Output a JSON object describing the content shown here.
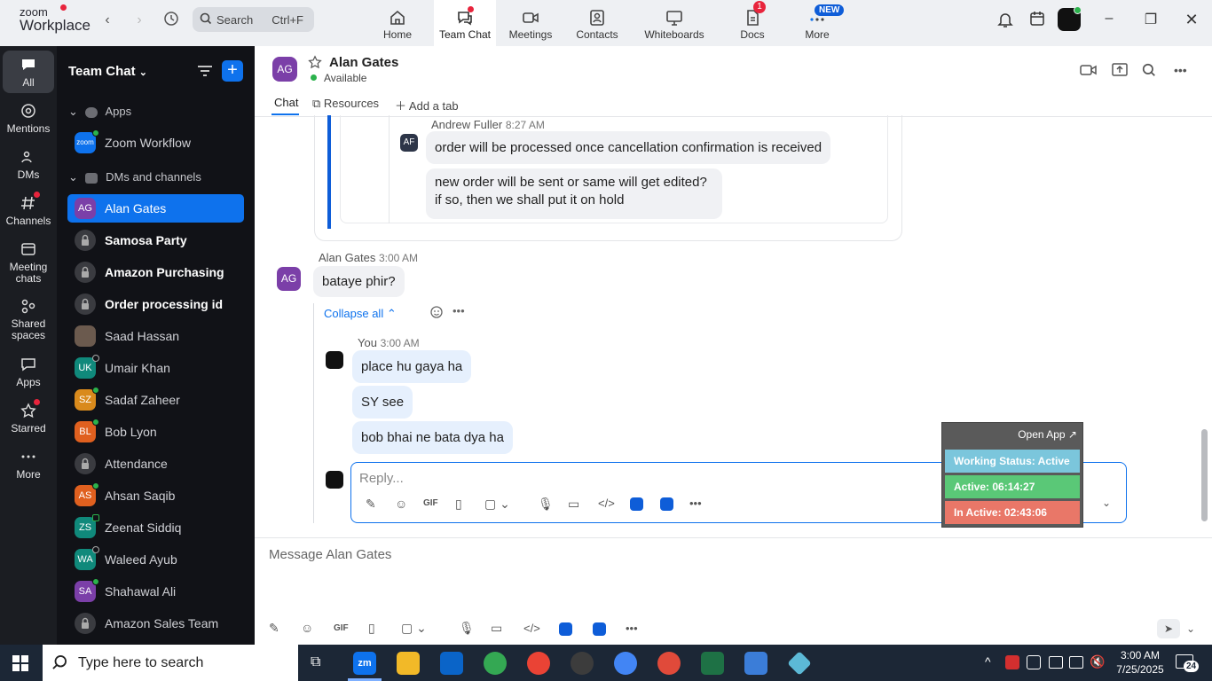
{
  "topbar": {
    "logo_line1": "zoom",
    "logo_line2": "Workplace",
    "search_placeholder": "Search",
    "search_shortcut": "Ctrl+F",
    "tabs": [
      {
        "label": "Home"
      },
      {
        "label": "Team Chat"
      },
      {
        "label": "Meetings"
      },
      {
        "label": "Contacts"
      },
      {
        "label": "Whiteboards"
      },
      {
        "label": "Docs",
        "badge": "1"
      },
      {
        "label": "More",
        "badge": "NEW"
      }
    ]
  },
  "rail": {
    "items": [
      {
        "label": "All"
      },
      {
        "label": "Mentions"
      },
      {
        "label": "DMs"
      },
      {
        "label": "Channels"
      },
      {
        "label": "Meeting chats"
      },
      {
        "label": "Shared spaces"
      },
      {
        "label": "Apps"
      },
      {
        "label": "Starred"
      },
      {
        "label": "More"
      }
    ]
  },
  "sidebar": {
    "title": "Team Chat",
    "sections": {
      "apps": "Apps",
      "dms": "DMs and channels"
    },
    "apps": [
      {
        "label": "Zoom Workflow",
        "avatar": "zoom"
      }
    ],
    "items": [
      {
        "label": "Alan Gates",
        "initials": "AG",
        "color": "#7b3fa8"
      },
      {
        "label": "Samosa Party"
      },
      {
        "label": "Amazon Purchasing"
      },
      {
        "label": "Order processing id"
      },
      {
        "label": "Saad Hassan"
      },
      {
        "label": "Umair Khan",
        "initials": "UK",
        "color": "#10897b"
      },
      {
        "label": "Sadaf Zaheer",
        "initials": "SZ",
        "color": "#d98a1c"
      },
      {
        "label": "Bob Lyon",
        "initials": "BL",
        "color": "#e0601f"
      },
      {
        "label": "Attendance"
      },
      {
        "label": "Ahsan Saqib",
        "initials": "AS",
        "color": "#e0601f"
      },
      {
        "label": "Zeenat Siddiq",
        "initials": "ZS",
        "color": "#10897b"
      },
      {
        "label": "Waleed Ayub",
        "initials": "WA",
        "color": "#10897b"
      },
      {
        "label": "Shahawal Ali",
        "initials": "SA",
        "color": "#7b3fa8"
      },
      {
        "label": "Amazon Sales Team"
      }
    ]
  },
  "chat": {
    "contact_initials": "AG",
    "contact_name": "Alan Gates",
    "contact_status": "Available",
    "tabs": {
      "chat": "Chat",
      "resources": "Resources",
      "add": "Add a tab"
    },
    "quoted": {
      "author": "Andrew Fuller",
      "time": "8:27 AM",
      "initials": "AF",
      "messages": [
        "order will be processed once cancellation confirmation is received",
        "new order will be sent or same will get edited?",
        "if so, then we shall put it on hold"
      ]
    },
    "message": {
      "author": "Alan Gates",
      "time": "3:00 AM",
      "initials": "AG",
      "text": "bataye phir?"
    },
    "collapse_label": "Collapse all",
    "reply": {
      "author": "You",
      "time": "3:00 AM",
      "messages": [
        "place hu gaya ha",
        "SY see",
        "bob bhai ne bata dya ha"
      ]
    },
    "reply_placeholder": "Reply...",
    "composer_placeholder": "Message Alan Gates",
    "gif": "GIF"
  },
  "widget": {
    "open_app": "Open App ↗",
    "working_status": "Working Status: Active",
    "active": "Active: 06:14:27",
    "inactive": "In Active: 02:43:06"
  },
  "taskbar": {
    "search_placeholder": "Type here to search",
    "time": "3:00 AM",
    "date": "7/25/2025",
    "notif_count": "24"
  }
}
